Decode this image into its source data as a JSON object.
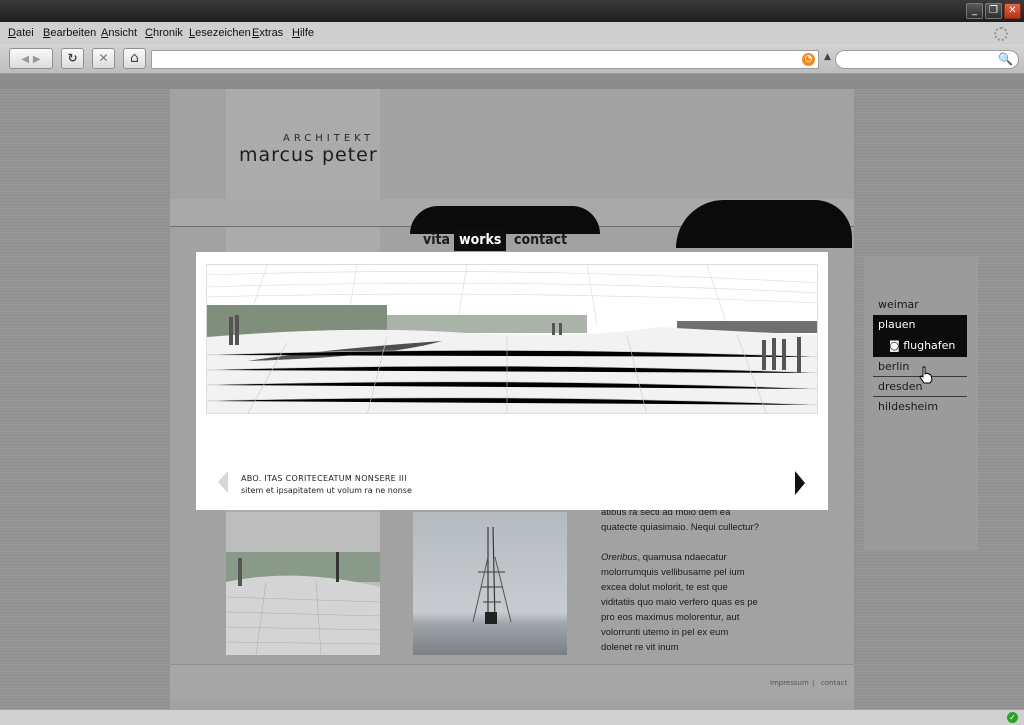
{
  "window": {
    "minimize_label": "_",
    "restore_label": "❐",
    "close_label": "✕"
  },
  "menu": {
    "items": [
      "Datei",
      "Bearbeiten",
      "Ansicht",
      "Chronik",
      "Lesezeichen",
      "Extras",
      "Hilfe"
    ]
  },
  "toolbar": {
    "back_label": "◀",
    "forward_label": "▶",
    "reload_label": "↻",
    "stop_label": "✕",
    "home_label": "⌂",
    "url_value": "",
    "search_value": "",
    "rss_label": "◔",
    "dropdown_label": "▲",
    "search_icon_label": "🔍"
  },
  "site": {
    "logo_small": "ARCHITEKT",
    "logo_big": "marcus peter",
    "nav": [
      {
        "label": "vita",
        "active": false
      },
      {
        "label": "works",
        "active": true
      },
      {
        "label": "contact",
        "active": false
      }
    ],
    "sidenav": {
      "weimar": "weimar",
      "plauen": "plauen",
      "flughafen": "flughafen",
      "flughafen_icon": "◙",
      "berlin": "berlin",
      "dresden": "dresden",
      "hildesheim": "hildesheim"
    },
    "body": {
      "p1": "atibus ra secti ad molo dem ea quatecte quiasimaio. Nequi cullectur?",
      "p2_em": "Oreribus",
      "p2": ", quamusa ndaecatur molorrumquis vellibusame pel ium excea dolut molorit, te est que viditatiis quo maio verfero quas es pe pro eos maximus molorentur, aut volorrunti utemo in pel ex eum dolenet re vit inum"
    },
    "footer": {
      "impressum": "impressum",
      "separator": "|",
      "contact": "contact"
    }
  },
  "lightbox": {
    "title": "ABO. ITAS CORITECEATUM NONSERE III",
    "subtitle": "sitem et ipsapitatem ut volum ra ne nonse"
  },
  "status": {
    "ok_label": "✓"
  }
}
